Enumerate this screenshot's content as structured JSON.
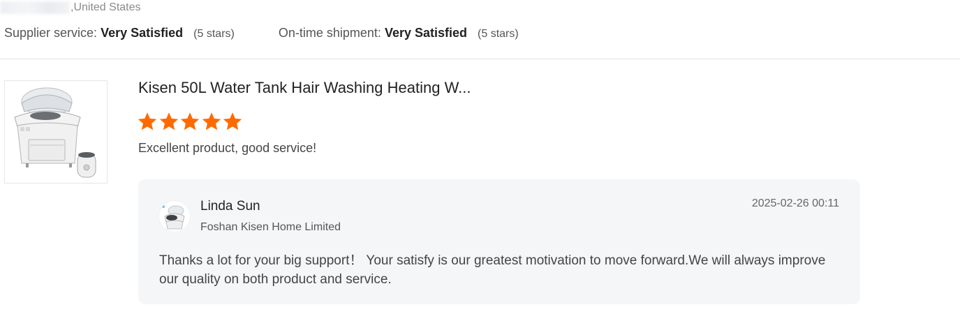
{
  "reviewer": {
    "location": ",United States"
  },
  "ratings": [
    {
      "label": "Supplier service:",
      "value": "Very Satisfied",
      "stars": "(5 stars)"
    },
    {
      "label": "On-time shipment:",
      "value": "Very Satisfied",
      "stars": "(5 stars)"
    }
  ],
  "product": {
    "image_icon": "shampoo-chair-icon",
    "title": "Kisen 50L Water Tank Hair Washing Heating W...",
    "rating": 5,
    "rating_max": 5,
    "star_color": "#ff6a00"
  },
  "review": {
    "text": "Excellent product, good service!"
  },
  "reply": {
    "name": "Linda Sun",
    "company": "Foshan Kisen Home Limited",
    "date": "2025-02-26 00:11",
    "message": "Thanks a lot for your big support！ Your satisfy is our greatest motivation to move forward.We will always improve our quality on both product and service."
  }
}
